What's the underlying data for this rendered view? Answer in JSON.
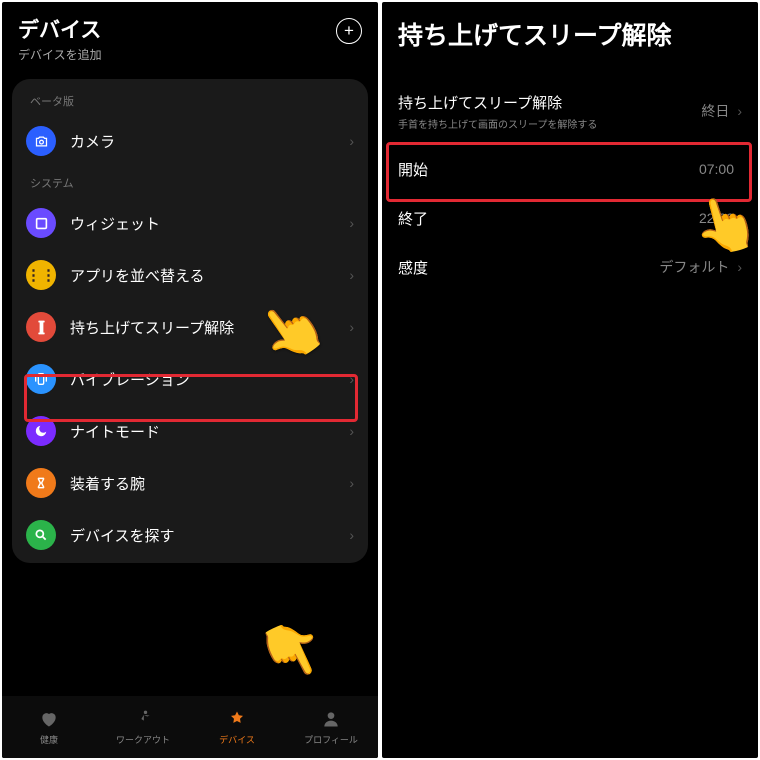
{
  "left": {
    "title": "デバイス",
    "subtitle": "デバイスを追加",
    "add_glyph": "+",
    "section_beta": "ベータ版",
    "section_system": "システム",
    "rows": {
      "camera": {
        "label": "カメラ",
        "icon": "camera-icon"
      },
      "widget": {
        "label": "ウィジェット",
        "icon": "widget-icon"
      },
      "rearrange": {
        "label": "アプリを並べ替える",
        "icon": "rearrange-icon"
      },
      "lift": {
        "label": "持ち上げてスリープ解除",
        "icon": "lift-icon"
      },
      "vibe": {
        "label": "バイブレーション",
        "icon": "vibration-icon"
      },
      "night": {
        "label": "ナイトモード",
        "icon": "night-icon"
      },
      "wrist": {
        "label": "装着する腕",
        "icon": "wrist-icon"
      },
      "find": {
        "label": "デバイスを探す",
        "icon": "find-icon"
      }
    },
    "tabs": {
      "health": "健康",
      "workout": "ワークアウト",
      "device": "デバイス",
      "profile": "プロフィール"
    }
  },
  "right": {
    "title": "持ち上げてスリープ解除",
    "rows": {
      "toggle": {
        "label": "持ち上げてスリープ解除",
        "desc": "手首を持ち上げて画面のスリープを解除する",
        "value": "終日"
      },
      "start": {
        "label": "開始",
        "value": "07:00"
      },
      "end": {
        "label": "終了",
        "value": "22:00"
      },
      "sens": {
        "label": "感度",
        "value": "デフォルト"
      }
    }
  },
  "annotation": {
    "hand_glyph": "👆"
  }
}
